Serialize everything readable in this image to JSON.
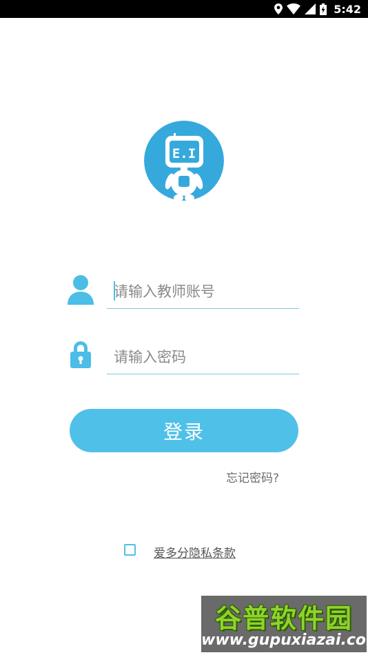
{
  "status_bar": {
    "time": "5:42",
    "icons": [
      "location-icon",
      "wifi-icon",
      "signal-icon",
      "battery-charging-icon"
    ]
  },
  "logo": {
    "text": "E.I",
    "icon": "robot-mascot-logo"
  },
  "account_field": {
    "placeholder": "请输入教师账号",
    "value": "",
    "icon": "user-icon"
  },
  "password_field": {
    "placeholder": "请输入密码",
    "value": "",
    "icon": "lock-icon"
  },
  "login_button": {
    "label": "登录"
  },
  "forgot_password": {
    "label": "忘记密码?"
  },
  "privacy": {
    "checked": false,
    "label": "爱多分隐私条款"
  },
  "watermark": {
    "title": "谷普软件园",
    "url": "www.gupuxiazai.com"
  },
  "colors": {
    "accent": "#4fc1e9",
    "logo_bg": "#36a9dc",
    "icon": "#4cbde6",
    "underline": "#7fc6df",
    "text_gray": "#6b6b6b"
  }
}
